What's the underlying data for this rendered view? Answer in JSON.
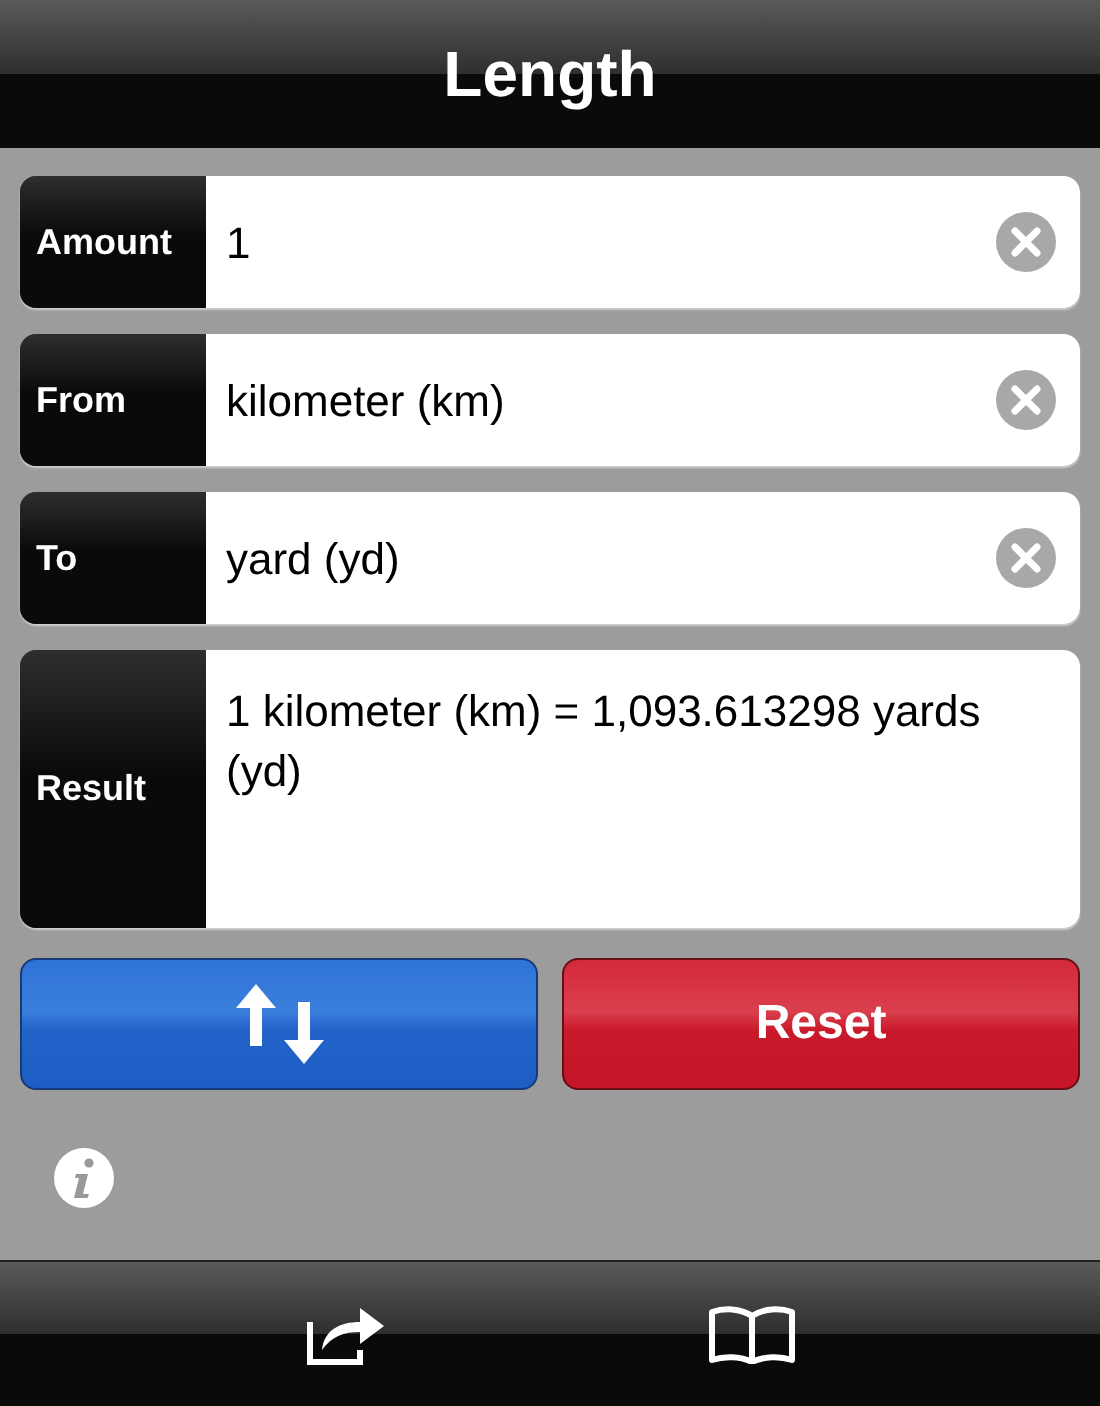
{
  "title": "Length",
  "fields": [
    {
      "kind": "input",
      "label": "Amount",
      "value": "1"
    },
    {
      "kind": "input",
      "label": "From",
      "value": "kilometer (km)"
    },
    {
      "kind": "input",
      "label": "To",
      "value": "yard (yd)"
    },
    {
      "kind": "result",
      "label": "Result",
      "value": "1 kilometer (km) = 1,093.613298 yards (yd)"
    }
  ],
  "reset_button": "Reset"
}
